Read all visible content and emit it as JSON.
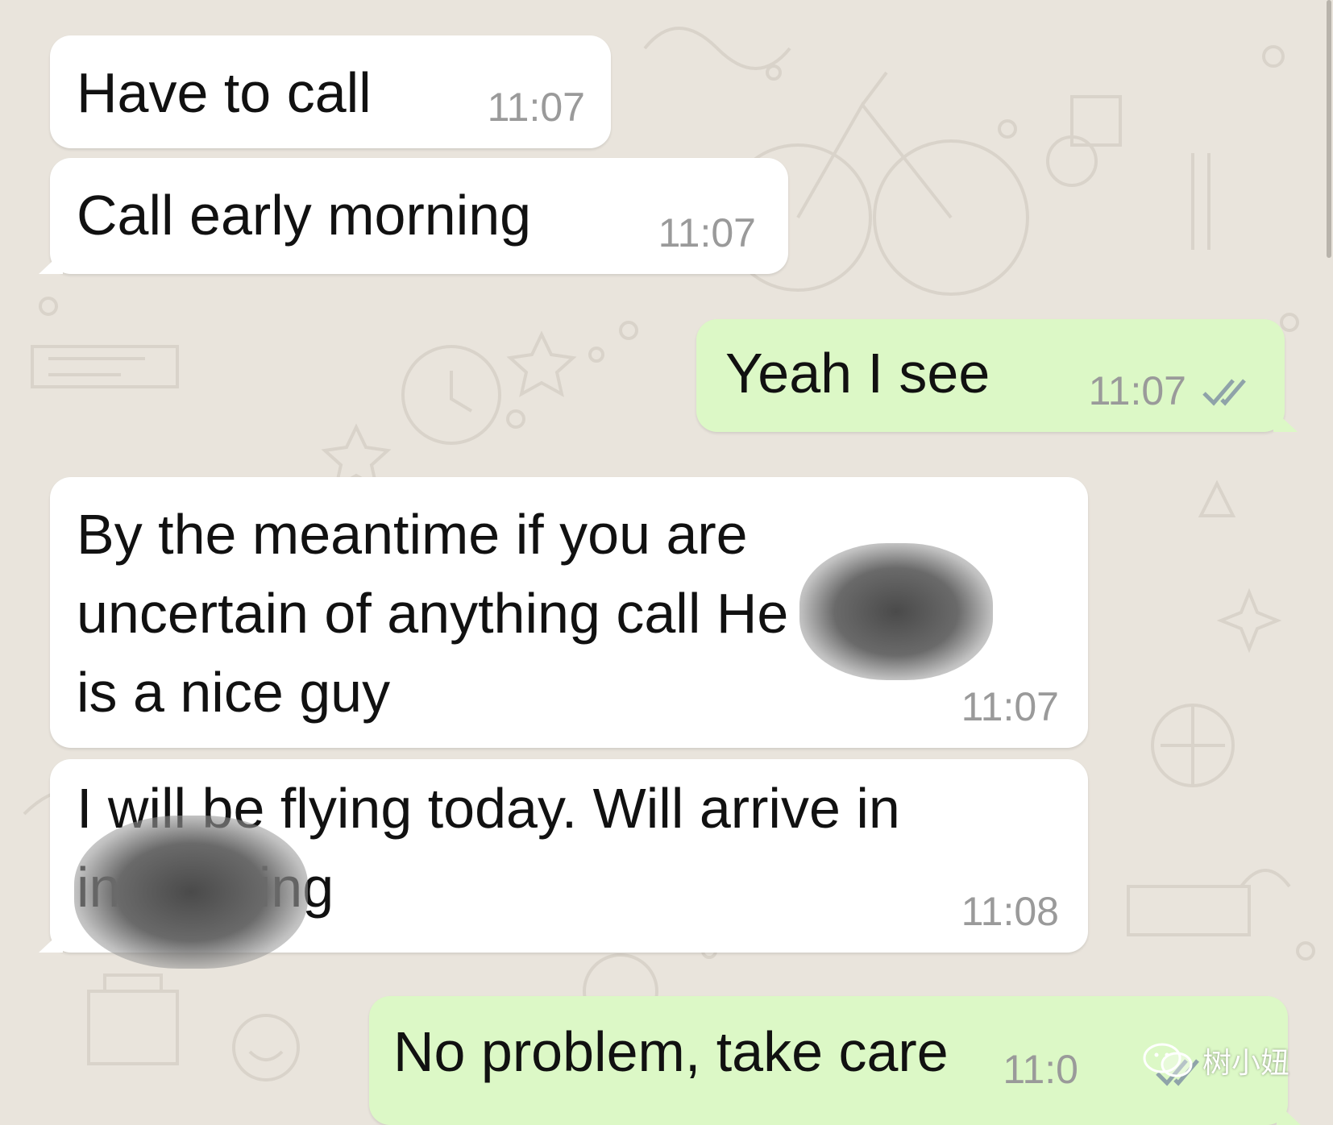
{
  "messages": [
    {
      "direction": "incoming",
      "text": "Have to call",
      "time": "11:07"
    },
    {
      "direction": "incoming",
      "text": "Call early morning",
      "time": "11:07"
    },
    {
      "direction": "outgoing",
      "text": "Yeah I see",
      "time": "11:07",
      "status": "read-double-check"
    },
    {
      "direction": "incoming",
      "text": "By the meantime if you are\nuncertain of anything call            He\nis a nice guy",
      "time": "11:07"
    },
    {
      "direction": "incoming",
      "text": "I will be flying today. Will arrive in\n                 in evening",
      "time": "11:08"
    },
    {
      "direction": "outgoing",
      "text": "No problem, take care",
      "time": "11:0",
      "status": "read-double-check"
    }
  ],
  "watermark": {
    "text": "树小妞",
    "icon": "wechat-icon"
  },
  "colors": {
    "background": "#e9e4dc",
    "incoming": "#ffffff",
    "outgoing": "#dcf8c6",
    "time": "#9a9a9a",
    "ticks": "#8fa3a9"
  }
}
